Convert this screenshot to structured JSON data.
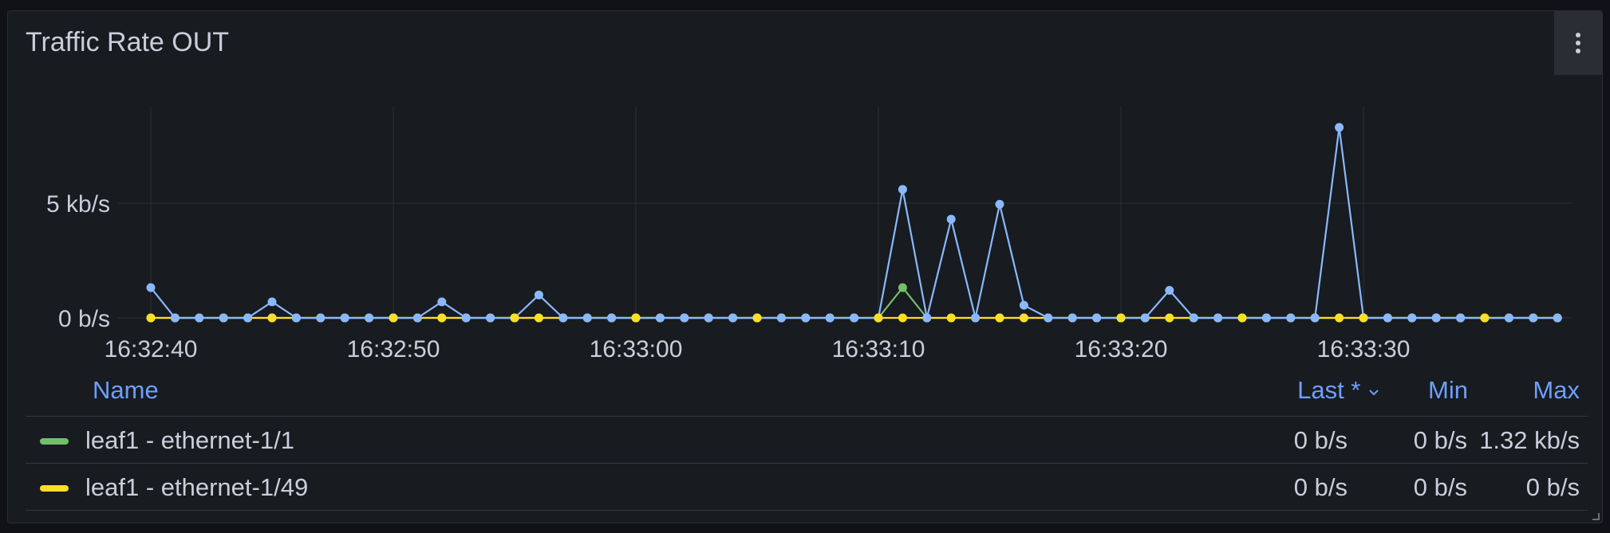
{
  "panel": {
    "title": "Traffic Rate OUT",
    "menu_icon": "kebab-menu-icon"
  },
  "legend": {
    "headers": {
      "name": "Name",
      "last": "Last *",
      "min": "Min",
      "max": "Max"
    },
    "sort_icon": "chevron-down-icon",
    "rows": [
      {
        "name": "leaf1 - ethernet-1/1",
        "color": "#73bf69",
        "last": "0 b/s",
        "min": "0 b/s",
        "max": "1.32 kb/s"
      },
      {
        "name": "leaf1 - ethernet-1/49",
        "color": "#fade2a",
        "last": "0 b/s",
        "min": "0 b/s",
        "max": "0 b/s"
      }
    ]
  },
  "chart_data": {
    "type": "line",
    "x_start": "16:32:40",
    "x_interval_seconds": 1,
    "x_ticks": [
      "16:32:40",
      "16:32:50",
      "16:33:00",
      "16:33:10",
      "16:33:20",
      "16:33:30"
    ],
    "y_ticks": [
      {
        "value": 0,
        "label": "0 b/s"
      },
      {
        "value": 5,
        "label": "5 kb/s"
      }
    ],
    "y_unit": "kb/s",
    "ylim": [
      0,
      9.2
    ],
    "grid": true,
    "series": [
      {
        "color": "#8ab8ff",
        "values": [
          1.32,
          0,
          0,
          0,
          0,
          0.7,
          0,
          0,
          0,
          0,
          0,
          0,
          0.7,
          0,
          0,
          0,
          1.0,
          0,
          0,
          0,
          0,
          0,
          0,
          0,
          0,
          0,
          0,
          0,
          0,
          0,
          0,
          5.6,
          0,
          4.3,
          0,
          4.95,
          0.55,
          0,
          0,
          0,
          0,
          0,
          1.2,
          0,
          0,
          0,
          0,
          0,
          0,
          8.3,
          0,
          0,
          0,
          0,
          0,
          0,
          0,
          0,
          0
        ]
      },
      {
        "name": "leaf1 - ethernet-1/1",
        "color": "#73bf69",
        "values": [
          0,
          0,
          0,
          0,
          0,
          0,
          0,
          0,
          0,
          0,
          0,
          0,
          0,
          0,
          0,
          0,
          0,
          0,
          0,
          0,
          0,
          0,
          0,
          0,
          0,
          0,
          0,
          0,
          0,
          0,
          0,
          1.32,
          0,
          0,
          0,
          0,
          0,
          0,
          0,
          0,
          0,
          0,
          0,
          0,
          0,
          0,
          0,
          0,
          0,
          0,
          0,
          0,
          0,
          0,
          0,
          0,
          0,
          0,
          0
        ]
      },
      {
        "name": "leaf1 - ethernet-1/49",
        "color": "#fade2a",
        "values": [
          0,
          0,
          0,
          0,
          0,
          0,
          0,
          0,
          0,
          0,
          0,
          0,
          0,
          0,
          0,
          0,
          0,
          0,
          0,
          0,
          0,
          0,
          0,
          0,
          0,
          0,
          0,
          0,
          0,
          0,
          0,
          0,
          0,
          0,
          0,
          0,
          0,
          0,
          0,
          0,
          0,
          0,
          0,
          0,
          0,
          0,
          0,
          0,
          0,
          0,
          0,
          0,
          0,
          0,
          0,
          0,
          0,
          0,
          0
        ]
      }
    ]
  }
}
